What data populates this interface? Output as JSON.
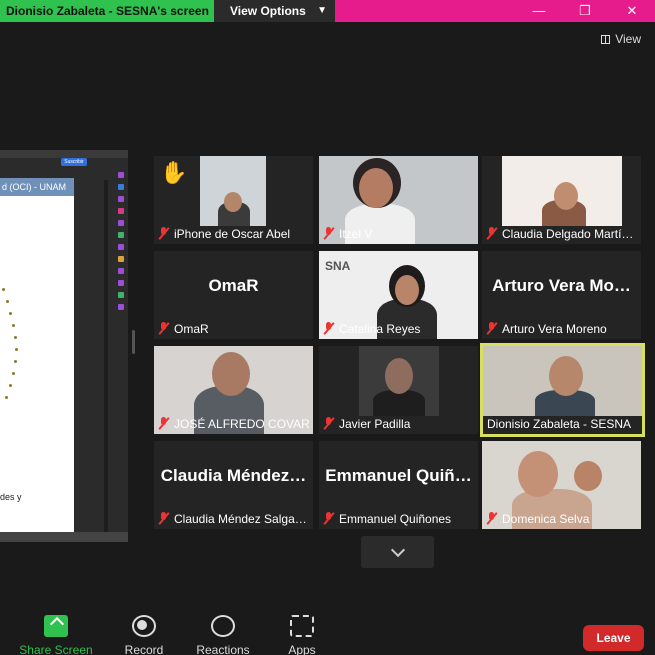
{
  "topbar": {
    "share_label": "Dionisio Zabaleta - SESNA's screen",
    "view_options": "View Options",
    "minimize": "—",
    "restore": "❐",
    "close": "✕"
  },
  "view_button": "View",
  "shared_screen": {
    "chip": "Suscribir",
    "doc_title": "d (OCI) - UNAM",
    "page_text": "des y"
  },
  "tiles": [
    {
      "caption": "iPhone de Oscar Abel",
      "muted": true,
      "raised_hand": true
    },
    {
      "caption": "Itzel V",
      "muted": true
    },
    {
      "caption": "Claudia Delgado Martí…",
      "muted": true
    },
    {
      "display": "OmaR",
      "caption": "OmaR",
      "muted": true
    },
    {
      "caption": "Catalina Reyes",
      "muted": true,
      "logo_text": "SNA"
    },
    {
      "display": "Arturo Vera Mo…",
      "caption": "Arturo Vera Moreno",
      "muted": true
    },
    {
      "caption": "JOSÉ ALFREDO COVAR…",
      "muted": true
    },
    {
      "caption": "Javier Padilla",
      "muted": true
    },
    {
      "caption": "Dionisio Zabaleta - SESNA",
      "muted": false,
      "active_speaker": true
    },
    {
      "display": "Claudia  Méndez…",
      "caption": "Claudia Méndez Salga…",
      "muted": true
    },
    {
      "display": "Emmanuel  Quiñ…",
      "caption": "Emmanuel Quiñones",
      "muted": true
    },
    {
      "caption": "Domenica Selva",
      "muted": true
    }
  ],
  "toolbar": {
    "share": "Share Screen",
    "record": "Record",
    "reactions": "Reactions",
    "apps": "Apps",
    "leave": "Leave"
  },
  "colors": {
    "share_bar": "#2fc24f",
    "top_bar": "#e61c8c",
    "active_border": "#d8de5d",
    "leave": "#d22a2a",
    "muted_mic": "#ee3333"
  }
}
